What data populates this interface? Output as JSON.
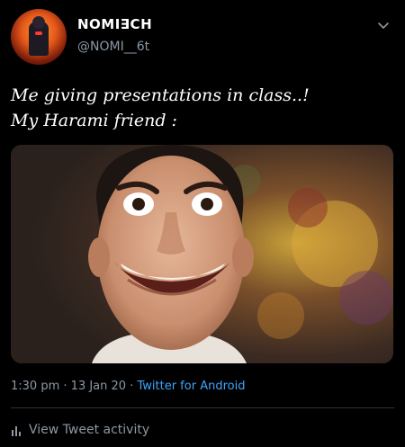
{
  "author": {
    "name": "NOMI∃CH",
    "handle": "@NOMI__6t"
  },
  "tweet": {
    "lines": [
      "Me giving presentations in class..!",
      "My Harami friend :"
    ]
  },
  "meta": {
    "time": "1:30 pm",
    "date": "13 Jan 20",
    "source": "Twitter for Android",
    "sep": "·"
  },
  "actions": {
    "activity_label": "View Tweet activity"
  },
  "colors": {
    "background": "#000000",
    "text": "#ffffff",
    "secondary": "#8b98a5",
    "link": "#3ea6ff",
    "divider": "#2f3336"
  }
}
